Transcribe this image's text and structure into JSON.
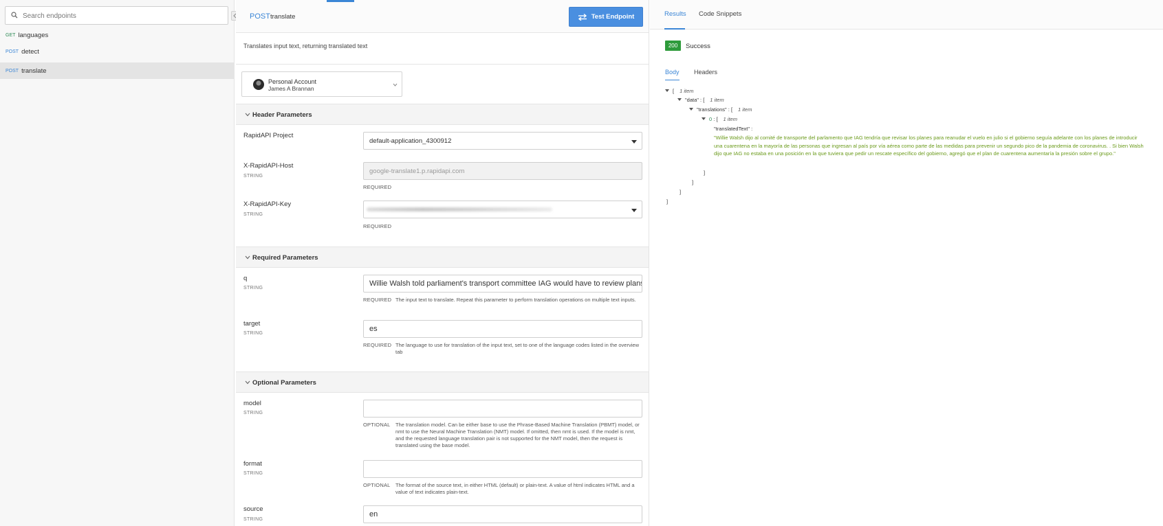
{
  "sidebar": {
    "search_placeholder": "Search endpoints",
    "endpoints": [
      {
        "method": "GET",
        "name": "languages"
      },
      {
        "method": "POST",
        "name": "detect"
      },
      {
        "method": "POST",
        "name": "translate"
      }
    ]
  },
  "endpoint": {
    "method": "POST",
    "name": "translate",
    "test_button": "Test Endpoint",
    "description": "Translates input text, returning translated text"
  },
  "account": {
    "label": "Personal Account",
    "user": "James A Brannan"
  },
  "header_params": {
    "title": "Header Parameters",
    "project": {
      "label": "RapidAPI Project",
      "value": "default-application_4300912"
    },
    "host": {
      "label": "X-RapidAPI-Host",
      "type": "STRING",
      "value": "google-translate1.p.rapidapi.com",
      "requirement": "REQUIRED"
    },
    "key": {
      "label": "X-RapidAPI-Key",
      "type": "STRING",
      "requirement": "REQUIRED"
    }
  },
  "required_params": {
    "title": "Required Parameters",
    "q": {
      "label": "q",
      "type": "STRING",
      "value": "Willie Walsh told parliament's transport committee IAG would have to review plans t",
      "requirement": "REQUIRED",
      "hint": "The input text to translate. Repeat this parameter to perform translation operations on multiple text inputs."
    },
    "target": {
      "label": "target",
      "type": "STRING",
      "value": "es",
      "requirement": "REQUIRED",
      "hint": "The language to use for translation of the input text, set to one of the language codes listed in the overview tab"
    }
  },
  "optional_params": {
    "title": "Optional Parameters",
    "model": {
      "label": "model",
      "type": "STRING",
      "value": "",
      "requirement": "OPTIONAL",
      "hint": "The translation model. Can be either base to use the Phrase-Based Machine Translation (PBMT) model, or nmt to use the Neural Machine Translation (NMT) model. If omitted, then nmt is used. If the model is nmt, and the requested language translation pair is not supported for the NMT model, then the request is translated using the base model."
    },
    "format": {
      "label": "format",
      "type": "STRING",
      "value": "",
      "requirement": "OPTIONAL",
      "hint": "The format of the source text, in either HTML (default) or plain-text. A value of html indicates HTML and a value of text indicates plain-text."
    },
    "source": {
      "label": "source",
      "type": "STRING",
      "value": "en"
    }
  },
  "results": {
    "tabs": [
      "Results",
      "Code Snippets"
    ],
    "status_code": "200",
    "status_text": "Success",
    "subtabs": [
      "Body",
      "Headers"
    ],
    "json": {
      "open_bracket": "[",
      "close_bracket": "]",
      "count_label": "1 item",
      "data_key": "\"data\" :",
      "translations_key": "\"translations\" :",
      "index_key": "0",
      "translated_key": "\"translatedText\" :",
      "translated_text": "\"Willie Walsh dijo al comité de transporte del parlamento que IAG tendría que revisar los planes para reanudar el vuelo en julio si el gobierno seguía adelante con los planes de introducir una cuarentena en la mayoría de las personas que ingresan al país por vía aérea como parte de las medidas para prevenir un segundo pico de la pandemia de coronavirus. . Si bien Walsh dijo que IAG no estaba en una posición en la que tuviera que pedir un rescate específico del gobierno, agregó que el plan de cuarentena aumentaría la presión sobre el grupo.\""
    }
  },
  "colors": {
    "accent": "#3b86d6",
    "success": "#2e9b3b",
    "json_string": "#6a9a1a",
    "get": "#2e8b57"
  }
}
